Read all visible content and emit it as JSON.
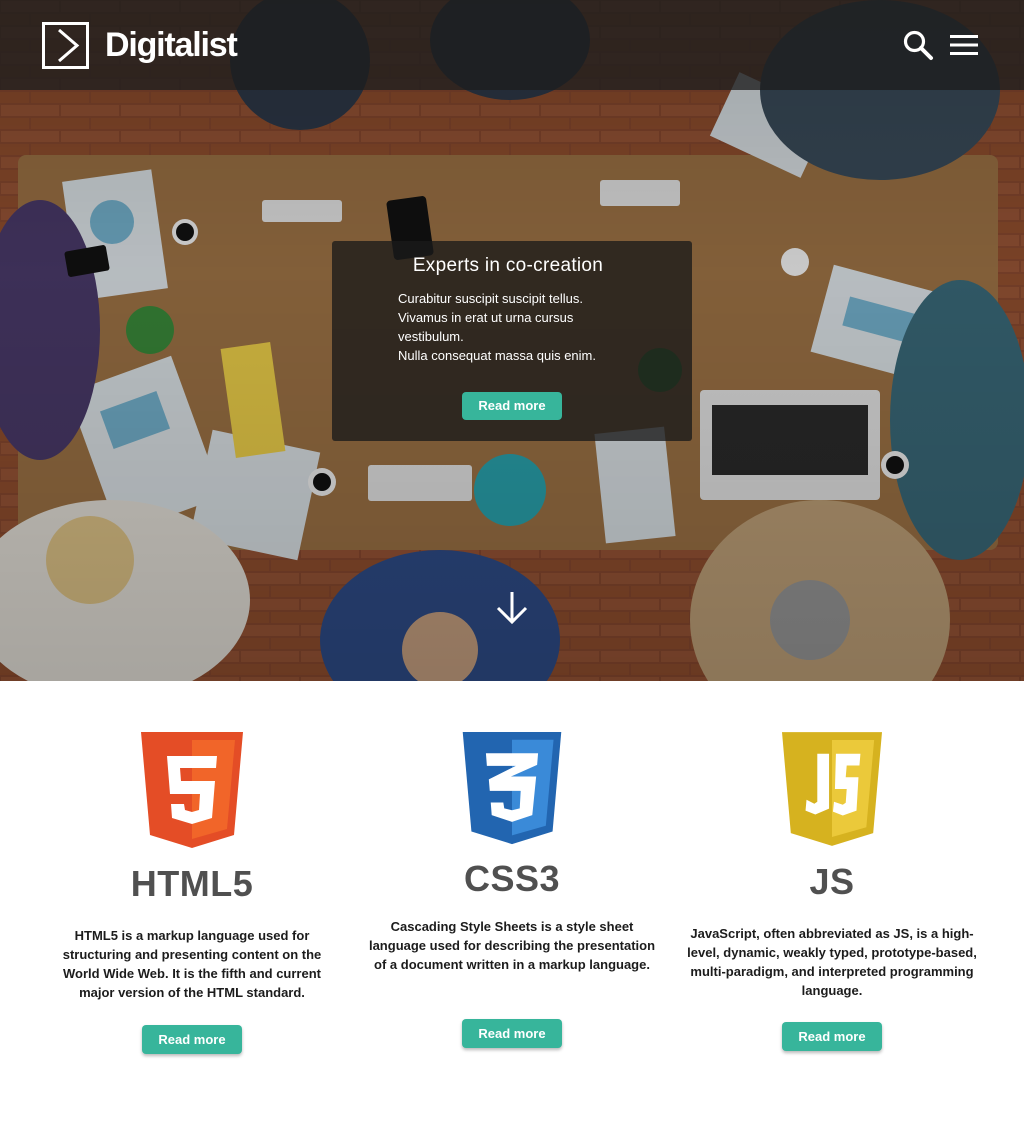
{
  "header": {
    "brand": "Digitalist"
  },
  "hero": {
    "title": "Experts in co-creation",
    "lines": [
      "Curabitur suscipit suscipit tellus.",
      "Vivamus in erat ut urna cursus",
      "vestibulum.",
      "Nulla consequat massa quis enim."
    ],
    "button_label": "Read more"
  },
  "features": [
    {
      "icon": "html5-shield-icon",
      "title": "HTML5",
      "text": "HTML5 is a markup language used for structuring and presenting content on the World Wide Web. It is the fifth and current major version of the HTML standard.",
      "button_label": "Read more"
    },
    {
      "icon": "css3-shield-icon",
      "title": "CSS3",
      "text": "Cascading Style Sheets is a style sheet language used for describing the presentation of a document written in a markup language.",
      "button_label": "Read more"
    },
    {
      "icon": "js-shield-icon",
      "title": "JS",
      "text": "JavaScript, often abbreviated as JS, is a high-level, dynamic, weakly typed, prototype-based, multi-paradigm, and interpreted programming language.",
      "button_label": "Read more"
    }
  ],
  "colors": {
    "accent": "#37b59b",
    "html5": "#e44d26",
    "css3": "#2965f1",
    "js": "#e8c52a",
    "heading": "#505050"
  }
}
